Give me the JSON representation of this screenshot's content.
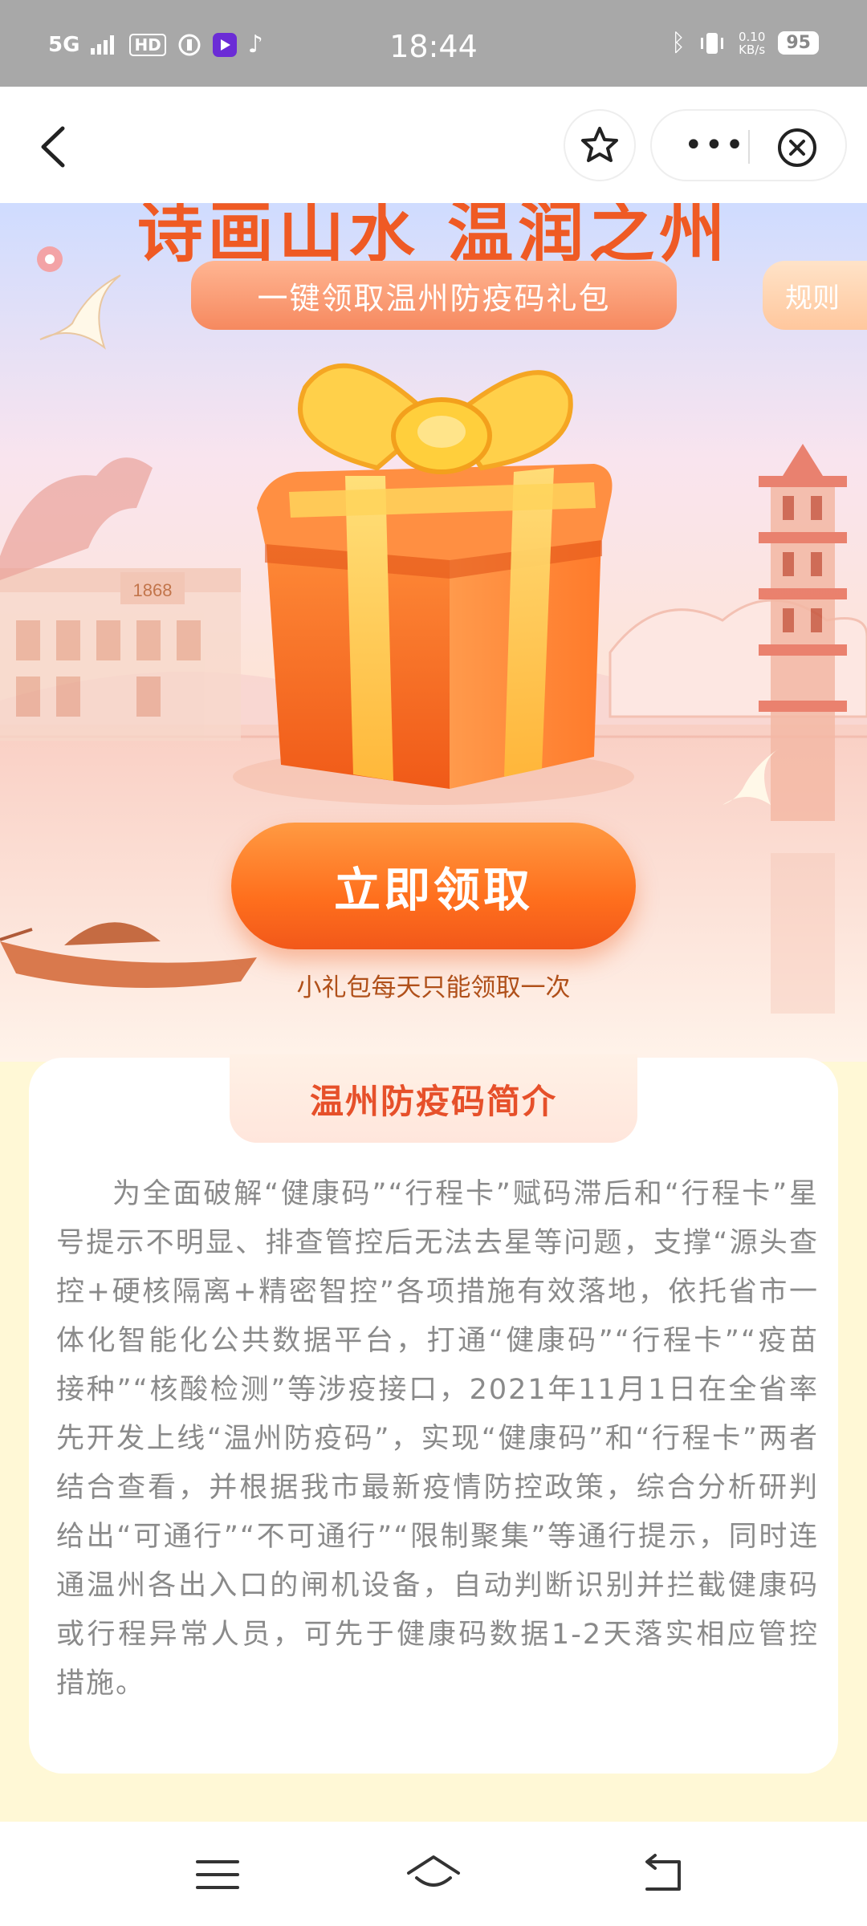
{
  "status_bar": {
    "network": "5G",
    "hd": "HD",
    "time": "18:44",
    "speed": "0.10\nKB/s",
    "battery": "95"
  },
  "nav": {
    "back_icon": "chevron-left-icon",
    "favorite_icon": "star-icon",
    "more_icon": "more-dots-icon",
    "close_icon": "close-circle-icon"
  },
  "hero": {
    "title": "诗画山水 温润之州",
    "banner": "一键领取温州防疫码礼包",
    "rules": "规则",
    "building_sign": "1868",
    "claim_button": "立即领取",
    "claim_note": "小礼包每天只能领取一次"
  },
  "intro": {
    "title": "温州防疫码简介",
    "body": "为全面破解“健康码”“行程卡”赋码滞后和“行程卡”星号提示不明显、排查管控后无法去星等问题，支撑“源头查控+硬核隔离+精密智控”各项措施有效落地，依托省市一体化智能化公共数据平台，打通“健康码”“行程卡”“疫苗接种”“核酸检测”等涉疫接口，2021年11月1日在全省率先开发上线“温州防疫码”，实现“健康码”和“行程卡”两者结合查看，并根据我市最新疫情防控政策，综合分析研判给出“可通行”“不可通行”“限制聚集”等通行提示，同时连通温州各出入口的闸机设备，自动判断识别并拦截健康码或行程异常人员，可先于健康码数据1-2天落实相应管控措施。"
  },
  "bottom_nav": {
    "menu_icon": "menu-icon",
    "home_icon": "home-icon",
    "back_icon": "return-icon"
  },
  "colors": {
    "accent": "#ff6f1d",
    "title_red": "#e6502a",
    "status_bar": "#a8a8a8"
  }
}
